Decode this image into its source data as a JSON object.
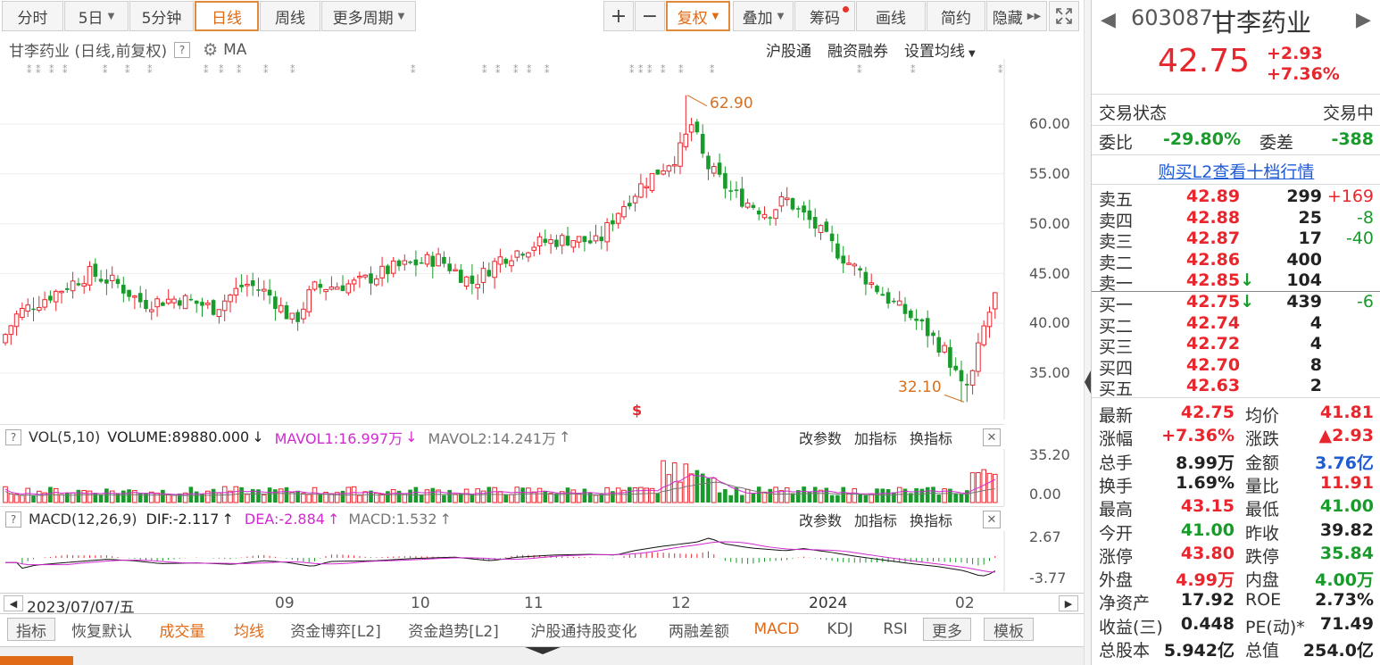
{
  "toolbar": {
    "tabs": [
      "分时",
      "5日",
      "5分钟",
      "日线",
      "周线",
      "更多周期"
    ],
    "active_tab": "日线",
    "plus": "+",
    "minus": "−",
    "fuquan": "复权",
    "overlay": "叠加",
    "chips": "筹码",
    "draw": "画线",
    "simple": "简约",
    "hide": "隐藏"
  },
  "chart_header": {
    "title": "甘李药业 (日线,前复权)",
    "help": "?",
    "ma": "MA",
    "links": [
      "沪股通",
      "融资融券",
      "设置均线"
    ]
  },
  "price_labels": {
    "high": "62.90",
    "low": "32.10",
    "s_marker": "$",
    "y_ticks": [
      "60.00",
      "55.00",
      "50.00",
      "45.00",
      "40.00",
      "35.00"
    ]
  },
  "vol_panel": {
    "name": "VOL(5,10)",
    "volume": "VOLUME:89880.000",
    "volume_arrow": "↓",
    "mavol1": "MAVOL1:16.997万",
    "mavol1_arrow": "↓",
    "mavol2": "MAVOL2:14.241万",
    "mavol2_arrow": "↑",
    "btns": [
      "改参数",
      "加指标",
      "换指标"
    ],
    "y_ticks": [
      "35.20",
      "0.00"
    ]
  },
  "macd_panel": {
    "name": "MACD(12,26,9)",
    "dif": "DIF:-2.117",
    "dif_arrow": "↑",
    "dea": "DEA:-2.884",
    "dea_arrow": "↑",
    "macd": "MACD:1.532",
    "macd_arrow": "↑",
    "btns": [
      "改参数",
      "加指标",
      "换指标"
    ],
    "y_ticks": [
      "2.67",
      "-3.77"
    ]
  },
  "xaxis": {
    "date": "2023/07/07/五",
    "labels": [
      "09",
      "10",
      "11",
      "12",
      "2024",
      "02"
    ]
  },
  "bottom_tabs": [
    "指标",
    "恢复默认",
    "成交量",
    "均线",
    "资金博弈[L2]",
    "资金趋势[L2]",
    "沪股通持股变化",
    "两融差额",
    "MACD",
    "KDJ",
    "RSI",
    "更多",
    "模板"
  ],
  "bottom_tabs_highlight": [
    "成交量",
    "均线",
    "MACD"
  ],
  "quote": {
    "code": "603087",
    "name": "甘李药业",
    "price": "42.75",
    "change": "+2.93",
    "change_pct": "+7.36%",
    "status_label": "交易状态",
    "status_value": "交易中",
    "wb_label": "委比",
    "wb_value": "-29.80%",
    "wc_label": "委差",
    "wc_value": "-388",
    "l2_link": "购买L2查看十档行情",
    "asks": [
      {
        "label": "卖五",
        "price": "42.89",
        "vol": "299",
        "chg": "+169",
        "chg_color": "red"
      },
      {
        "label": "卖四",
        "price": "42.88",
        "vol": "25",
        "chg": "-8",
        "chg_color": "green"
      },
      {
        "label": "卖三",
        "price": "42.87",
        "vol": "17",
        "chg": "-40",
        "chg_color": "green"
      },
      {
        "label": "卖二",
        "price": "42.86",
        "vol": "400",
        "chg": "",
        "chg_color": "red"
      },
      {
        "label": "卖一",
        "price": "42.85",
        "vol": "104",
        "chg": "",
        "chg_color": "red",
        "arrow": "↓"
      }
    ],
    "bids": [
      {
        "label": "买一",
        "price": "42.75",
        "vol": "439",
        "chg": "-6",
        "chg_color": "green",
        "arrow": "↓"
      },
      {
        "label": "买二",
        "price": "42.74",
        "vol": "4",
        "chg": "",
        "chg_color": "red"
      },
      {
        "label": "买三",
        "price": "42.72",
        "vol": "4",
        "chg": "",
        "chg_color": "red"
      },
      {
        "label": "买四",
        "price": "42.70",
        "vol": "8",
        "chg": "",
        "chg_color": "red"
      },
      {
        "label": "买五",
        "price": "42.63",
        "vol": "2",
        "chg": "",
        "chg_color": "red"
      }
    ],
    "stats": [
      [
        "最新",
        "42.75",
        "red",
        "均价",
        "41.81",
        "red"
      ],
      [
        "涨幅",
        "+7.36%",
        "red",
        "涨跌",
        "▲2.93",
        "red"
      ],
      [
        "总手",
        "8.99万",
        "dark",
        "金额",
        "3.76亿",
        "blue"
      ],
      [
        "换手",
        "1.69%",
        "dark",
        "量比",
        "11.91",
        "red"
      ],
      [
        "最高",
        "43.15",
        "red",
        "最低",
        "41.00",
        "green"
      ],
      [
        "今开",
        "41.00",
        "green",
        "昨收",
        "39.82",
        "dark"
      ],
      [
        "涨停",
        "43.80",
        "red",
        "跌停",
        "35.84",
        "green"
      ],
      [
        "外盘",
        "4.99万",
        "red",
        "内盘",
        "4.00万",
        "green"
      ],
      [
        "净资产",
        "17.92",
        "dark",
        "ROE",
        "2.73%",
        "dark"
      ],
      [
        "收益(三)",
        "0.448",
        "dark",
        "PE(动)*",
        "71.49",
        "dark"
      ],
      [
        "总股本",
        "5.942亿",
        "dark",
        "总值",
        "254.0亿",
        "dark"
      ]
    ]
  },
  "colors": {
    "up": "#e8262d",
    "down": "#189b2a",
    "accent": "#e06a16",
    "link": "#1e5bd6"
  }
}
